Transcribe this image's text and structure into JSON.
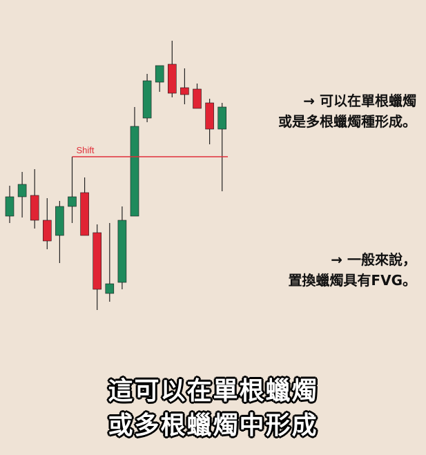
{
  "chart_data": {
    "type": "candlestick",
    "ylim": [
      0,
      100
    ],
    "grid": false,
    "colors": {
      "up": "#1f8a5c",
      "down": "#e02434",
      "wick": "#222222",
      "shift_line": "#e0303a"
    },
    "candles": [
      {
        "open": 40.5,
        "high": 51.5,
        "low": 38.0,
        "close": 47.5
      },
      {
        "open": 47.5,
        "high": 56.5,
        "low": 40.0,
        "close": 52.0
      },
      {
        "open": 48.0,
        "high": 57.5,
        "low": 36.0,
        "close": 39.0
      },
      {
        "open": 39.0,
        "high": 47.0,
        "low": 28.5,
        "close": 31.5
      },
      {
        "open": 33.5,
        "high": 46.0,
        "low": 23.5,
        "close": 44.0
      },
      {
        "open": 44.0,
        "high": 62.0,
        "low": 38.0,
        "close": 47.5
      },
      {
        "open": 49.0,
        "high": 54.5,
        "low": 33.5,
        "close": 33.5
      },
      {
        "open": 34.5,
        "high": 37.5,
        "low": 6.5,
        "close": 14.0
      },
      {
        "open": 12.5,
        "high": 38.0,
        "low": 9.5,
        "close": 16.0
      },
      {
        "open": 16.5,
        "high": 44.0,
        "low": 14.0,
        "close": 39.0
      },
      {
        "open": 40.5,
        "high": 80.0,
        "low": 40.5,
        "close": 73.0
      },
      {
        "open": 76.0,
        "high": 92.0,
        "low": 74.5,
        "close": 89.5
      },
      {
        "open": 89.0,
        "high": 95.0,
        "low": 85.5,
        "close": 95.0
      },
      {
        "open": 95.5,
        "high": 104.0,
        "low": 83.5,
        "close": 85.0
      },
      {
        "open": 87.0,
        "high": 94.0,
        "low": 81.0,
        "close": 84.5
      },
      {
        "open": 86.5,
        "high": 88.5,
        "low": 79.5,
        "close": 79.5
      },
      {
        "open": 81.5,
        "high": 83.0,
        "low": 66.5,
        "close": 72.0
      },
      {
        "open": 72.0,
        "high": 81.5,
        "low": 49.5,
        "close": 80.0
      }
    ],
    "shift": {
      "label": "Shift",
      "level": 62.0,
      "from_index": 5
    }
  },
  "notes": [
    {
      "lines": [
        "→ 可以在單根蠟燭",
        "或是多根蠟燭種形成。"
      ]
    },
    {
      "lines": [
        "→ 一般來說，",
        "置換蠟燭具有FVG。"
      ]
    }
  ],
  "subtitle": {
    "lines": [
      "這可以在單根蠟燭",
      "或多根蠟燭中形成"
    ]
  }
}
